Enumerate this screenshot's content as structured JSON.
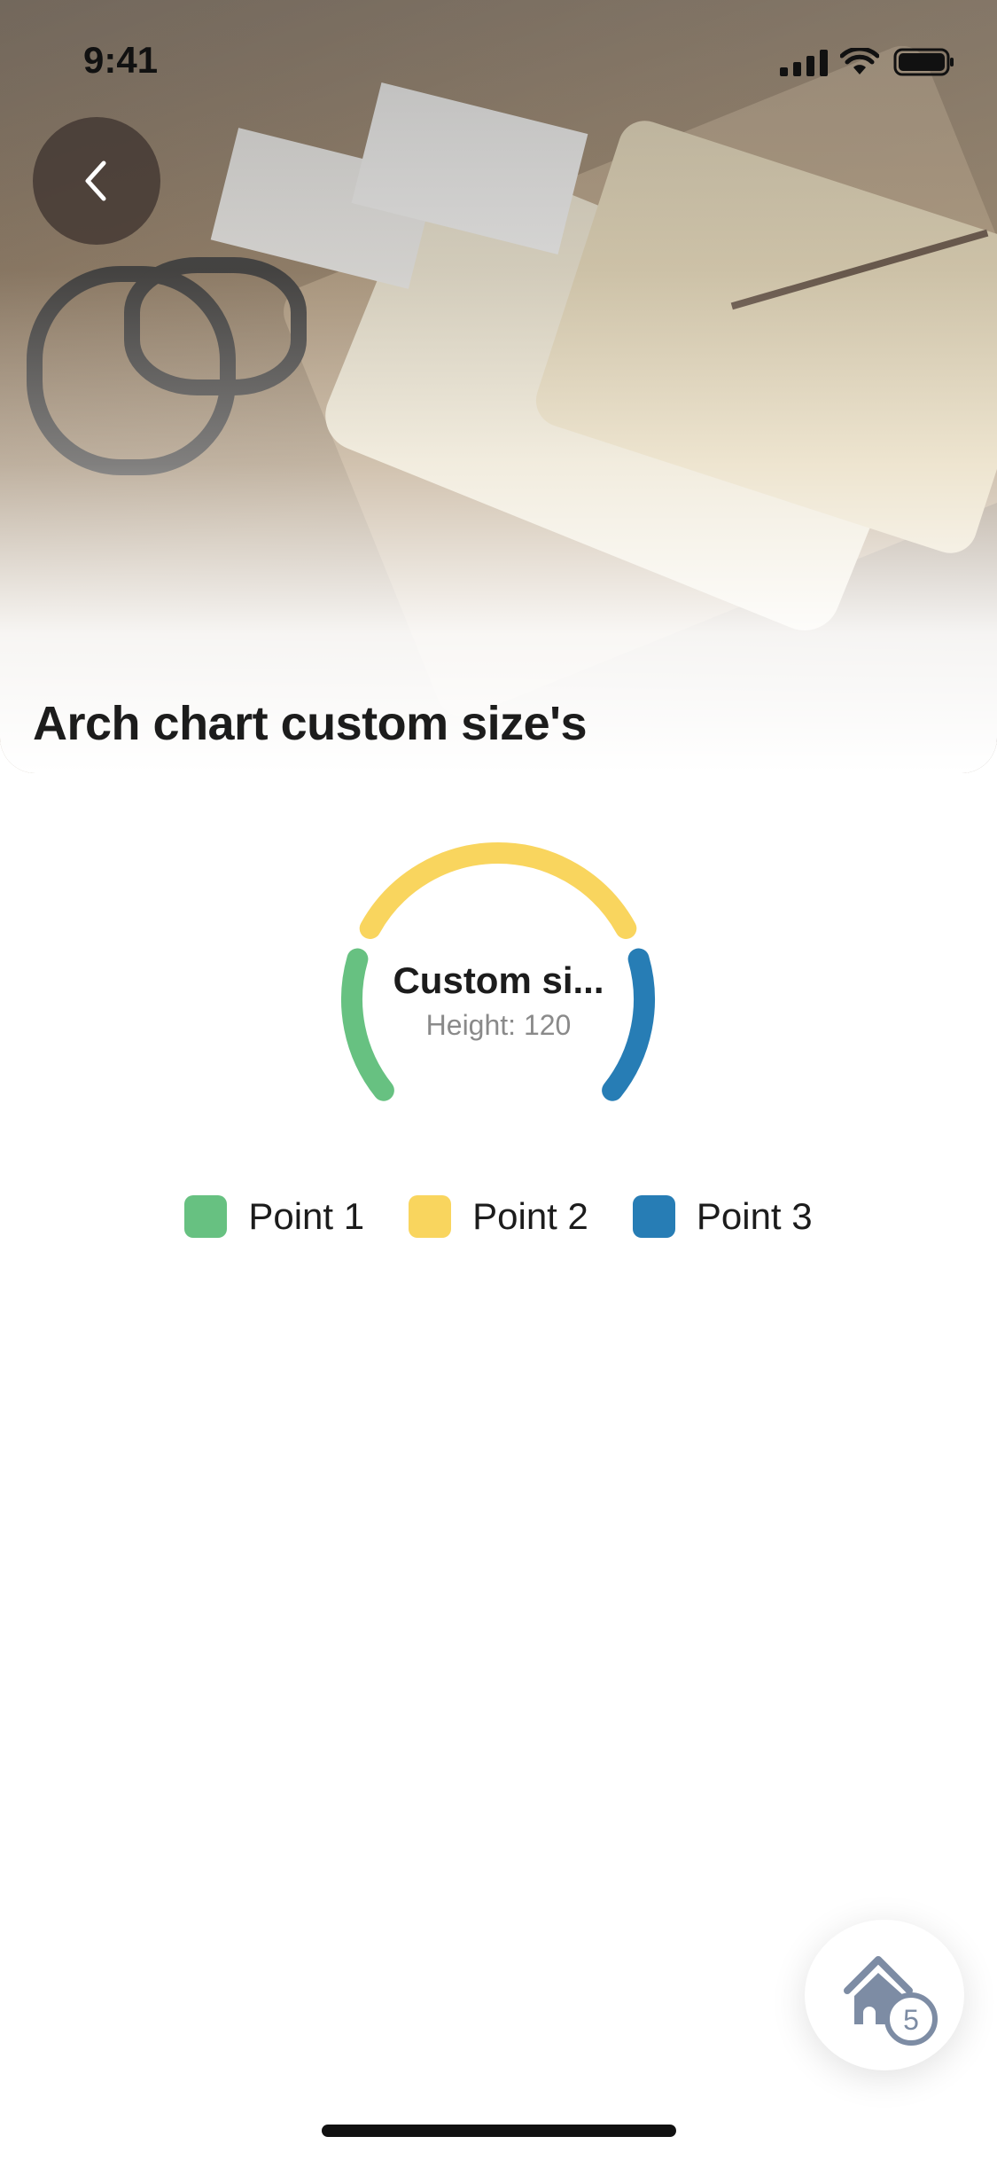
{
  "status_bar": {
    "time": "9:41"
  },
  "header": {
    "title": "Arch chart custom size's"
  },
  "chart_data": {
    "type": "arch",
    "title": "Custom si...",
    "subtitle": "Height: 120",
    "categories": [
      "Point 1",
      "Point 2",
      "Point 3"
    ],
    "values": [
      25,
      50,
      25
    ],
    "colors": [
      "#67c181",
      "#f9d55e",
      "#277db5"
    ],
    "legend_placement": "bottom"
  },
  "home_button": {
    "badge": "5"
  }
}
